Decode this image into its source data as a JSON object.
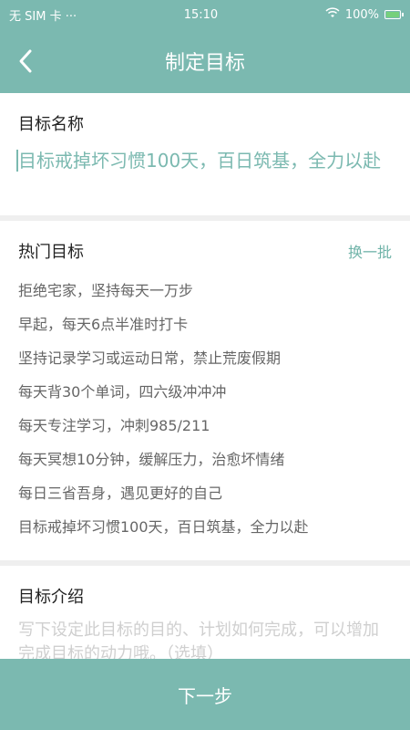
{
  "status_bar": {
    "carrier": "无 SIM 卡 ···",
    "time": "15:10",
    "battery": "100%"
  },
  "nav": {
    "title": "制定目标",
    "back_icon": "back-chevron-icon"
  },
  "goal_name": {
    "label": "目标名称",
    "value": "目标戒掉坏习惯100天，百日筑基，全力以赴"
  },
  "hot_goals": {
    "label": "热门目标",
    "refresh": "换一批",
    "items": [
      "拒绝宅家，坚持每天一万步",
      "早起，每天6点半准时打卡",
      "坚持记录学习或运动日常，禁止荒废假期",
      "每天背30个单词，四六级冲冲冲",
      "每天专注学习，冲刺985/211",
      "每天冥想10分钟，缓解压力，治愈坏情绪",
      "每日三省吾身，遇见更好的自己",
      "目标戒掉坏习惯100天，百日筑基，全力以赴"
    ]
  },
  "goal_intro": {
    "label": "目标介绍",
    "placeholder": "写下设定此目标的目的、计划如何完成，可以增加完成目标的动力哦。（选填）"
  },
  "next_button": "下一步",
  "colors": {
    "primary": "#7bb9b0",
    "background": "#efefef",
    "white": "#ffffff"
  }
}
